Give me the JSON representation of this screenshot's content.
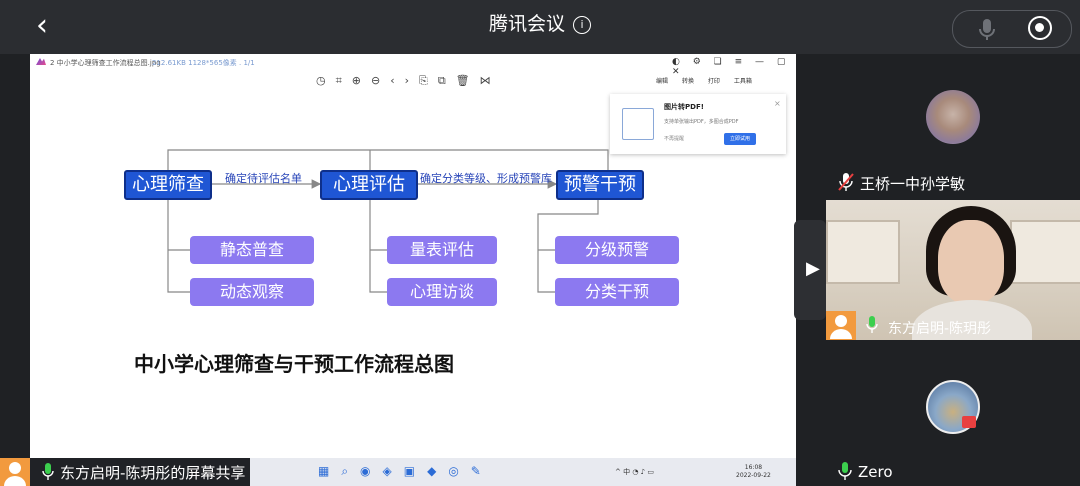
{
  "meeting": {
    "title": "腾讯会议",
    "info_icon": "info-icon"
  },
  "viewer": {
    "filename": "2 中小学心理筛查工作流程总图.jpg",
    "filemeta": "212.61KB  1128*565像素 . 1/1",
    "tools_right": [
      "编辑",
      "转换",
      "打印",
      "工具箱"
    ]
  },
  "popup": {
    "title": "图片转PDF!",
    "desc": "支持单张输出PDF，多图合成PDF",
    "dismiss": "不再提醒",
    "action": "立即试用"
  },
  "flow": {
    "main": [
      "心理筛查",
      "心理评估",
      "预警干预"
    ],
    "edge_labels": [
      "确定待评估名单",
      "确定分类等级、形成预警库"
    ],
    "sub1": [
      "静态普查",
      "动态观察"
    ],
    "sub2": [
      "量表评估",
      "心理访谈"
    ],
    "sub3": [
      "分级预警",
      "分类干预"
    ],
    "caption": "中小学心理筛查与干预工作流程总图"
  },
  "taskbar": {
    "tray": "中",
    "clock_time": "16:08",
    "clock_date": "2022-09-22"
  },
  "presenter": {
    "label": "东方启明-陈玥彤的屏幕共享"
  },
  "participants": [
    {
      "name": "王桥一中孙学敏",
      "muted": true
    },
    {
      "name": "东方启明-陈玥彤",
      "muted": false
    },
    {
      "name": "Zero",
      "muted": false
    }
  ],
  "colors": {
    "accent_blue": "#1f56d4",
    "sub_purple": "#8c79f0",
    "presenter_orange": "#f29a3e",
    "mic_green": "#3ccf4e"
  }
}
